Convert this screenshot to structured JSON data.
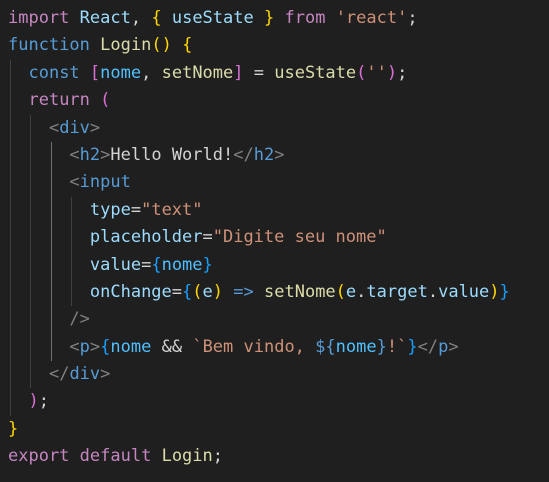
{
  "editor": {
    "language": "javascript-react",
    "lines": [
      {
        "tokens": [
          {
            "t": "import",
            "c": "kw-import"
          },
          {
            "t": " ",
            "c": "text"
          },
          {
            "t": "React",
            "c": "var"
          },
          {
            "t": ", ",
            "c": "text"
          },
          {
            "t": "{",
            "c": "b1"
          },
          {
            "t": " ",
            "c": "text"
          },
          {
            "t": "useState",
            "c": "var"
          },
          {
            "t": " ",
            "c": "text"
          },
          {
            "t": "}",
            "c": "b1"
          },
          {
            "t": " ",
            "c": "text"
          },
          {
            "t": "from",
            "c": "kw-import"
          },
          {
            "t": " ",
            "c": "text"
          },
          {
            "t": "'react'",
            "c": "str"
          },
          {
            "t": ";",
            "c": "text"
          }
        ]
      },
      {
        "tokens": [
          {
            "t": "function",
            "c": "kw"
          },
          {
            "t": " ",
            "c": "text"
          },
          {
            "t": "Login",
            "c": "fn"
          },
          {
            "t": "()",
            "c": "b1"
          },
          {
            "t": " ",
            "c": "text"
          },
          {
            "t": "{",
            "c": "b1"
          }
        ]
      },
      {
        "tokens": [
          {
            "t": "  ",
            "c": "text"
          },
          {
            "t": "const",
            "c": "kw"
          },
          {
            "t": " ",
            "c": "text"
          },
          {
            "t": "[",
            "c": "b2"
          },
          {
            "t": "nome",
            "c": "const"
          },
          {
            "t": ", ",
            "c": "text"
          },
          {
            "t": "setNome",
            "c": "fn"
          },
          {
            "t": "]",
            "c": "b2"
          },
          {
            "t": " = ",
            "c": "op"
          },
          {
            "t": "useState",
            "c": "fn"
          },
          {
            "t": "(",
            "c": "b2"
          },
          {
            "t": "''",
            "c": "str"
          },
          {
            "t": ")",
            "c": "b2"
          },
          {
            "t": ";",
            "c": "text"
          }
        ]
      },
      {
        "tokens": [
          {
            "t": "  ",
            "c": "text"
          },
          {
            "t": "return",
            "c": "kw-import"
          },
          {
            "t": " ",
            "c": "text"
          },
          {
            "t": "(",
            "c": "b2"
          }
        ]
      },
      {
        "tokens": [
          {
            "t": "    ",
            "c": "text"
          },
          {
            "t": "<",
            "c": "angle"
          },
          {
            "t": "div",
            "c": "tag"
          },
          {
            "t": ">",
            "c": "angle"
          }
        ]
      },
      {
        "tokens": [
          {
            "t": "      ",
            "c": "text"
          },
          {
            "t": "<",
            "c": "angle"
          },
          {
            "t": "h2",
            "c": "tag"
          },
          {
            "t": ">",
            "c": "angle"
          },
          {
            "t": "Hello World!",
            "c": "text"
          },
          {
            "t": "</",
            "c": "angle"
          },
          {
            "t": "h2",
            "c": "tag"
          },
          {
            "t": ">",
            "c": "angle"
          }
        ]
      },
      {
        "tokens": [
          {
            "t": "      ",
            "c": "text"
          },
          {
            "t": "<",
            "c": "angle"
          },
          {
            "t": "input",
            "c": "tag"
          }
        ]
      },
      {
        "tokens": [
          {
            "t": "        ",
            "c": "text"
          },
          {
            "t": "type",
            "c": "attr"
          },
          {
            "t": "=",
            "c": "op"
          },
          {
            "t": "\"text\"",
            "c": "str"
          }
        ]
      },
      {
        "tokens": [
          {
            "t": "        ",
            "c": "text"
          },
          {
            "t": "placeholder",
            "c": "attr"
          },
          {
            "t": "=",
            "c": "op"
          },
          {
            "t": "\"Digite seu nome\"",
            "c": "str"
          }
        ]
      },
      {
        "tokens": [
          {
            "t": "        ",
            "c": "text"
          },
          {
            "t": "value",
            "c": "attr"
          },
          {
            "t": "=",
            "c": "op"
          },
          {
            "t": "{",
            "c": "b3"
          },
          {
            "t": "nome",
            "c": "const"
          },
          {
            "t": "}",
            "c": "b3"
          }
        ]
      },
      {
        "tokens": [
          {
            "t": "        ",
            "c": "text"
          },
          {
            "t": "onChange",
            "c": "attr"
          },
          {
            "t": "=",
            "c": "op"
          },
          {
            "t": "{",
            "c": "b3"
          },
          {
            "t": "(",
            "c": "b1"
          },
          {
            "t": "e",
            "c": "var"
          },
          {
            "t": ")",
            "c": "b1"
          },
          {
            "t": " ",
            "c": "text"
          },
          {
            "t": "=>",
            "c": "kw"
          },
          {
            "t": " ",
            "c": "text"
          },
          {
            "t": "setNome",
            "c": "fn"
          },
          {
            "t": "(",
            "c": "b1"
          },
          {
            "t": "e",
            "c": "var"
          },
          {
            "t": ".",
            "c": "text"
          },
          {
            "t": "target",
            "c": "var"
          },
          {
            "t": ".",
            "c": "text"
          },
          {
            "t": "value",
            "c": "var"
          },
          {
            "t": ")",
            "c": "b1"
          },
          {
            "t": "}",
            "c": "b3"
          }
        ]
      },
      {
        "tokens": [
          {
            "t": "      ",
            "c": "text"
          },
          {
            "t": "/>",
            "c": "angle"
          }
        ]
      },
      {
        "tokens": [
          {
            "t": "      ",
            "c": "text"
          },
          {
            "t": "<",
            "c": "angle"
          },
          {
            "t": "p",
            "c": "tag"
          },
          {
            "t": ">",
            "c": "angle"
          },
          {
            "t": "{",
            "c": "b3"
          },
          {
            "t": "nome",
            "c": "const"
          },
          {
            "t": " && ",
            "c": "op"
          },
          {
            "t": "`Bem vindo, ",
            "c": "str"
          },
          {
            "t": "${",
            "c": "tmpl-d"
          },
          {
            "t": "nome",
            "c": "const"
          },
          {
            "t": "}",
            "c": "tmpl-d"
          },
          {
            "t": "!`",
            "c": "str"
          },
          {
            "t": "}",
            "c": "b3"
          },
          {
            "t": "</",
            "c": "angle"
          },
          {
            "t": "p",
            "c": "tag"
          },
          {
            "t": ">",
            "c": "angle"
          }
        ]
      },
      {
        "tokens": [
          {
            "t": "    ",
            "c": "text"
          },
          {
            "t": "</",
            "c": "angle"
          },
          {
            "t": "div",
            "c": "tag"
          },
          {
            "t": ">",
            "c": "angle"
          }
        ]
      },
      {
        "tokens": [
          {
            "t": "  ",
            "c": "text"
          },
          {
            "t": ")",
            "c": "b2"
          },
          {
            "t": ";",
            "c": "text"
          }
        ]
      },
      {
        "tokens": [
          {
            "t": "}",
            "c": "b1"
          }
        ]
      },
      {
        "tokens": [
          {
            "t": "export",
            "c": "kw-import"
          },
          {
            "t": " ",
            "c": "text"
          },
          {
            "t": "default",
            "c": "kw-import"
          },
          {
            "t": " ",
            "c": "text"
          },
          {
            "t": "Login",
            "c": "fn"
          },
          {
            "t": ";",
            "c": "text"
          }
        ]
      }
    ]
  },
  "colors": {
    "background": "#1f1f1f",
    "keyword_control": "#c586c0",
    "keyword": "#569cd6",
    "function": "#dcdcaa",
    "variable": "#9cdcfe",
    "constant": "#4fc1ff",
    "string": "#ce9178",
    "bracket_gold": "#ffd700",
    "bracket_orchid": "#da70d6",
    "bracket_blue": "#179fff"
  }
}
